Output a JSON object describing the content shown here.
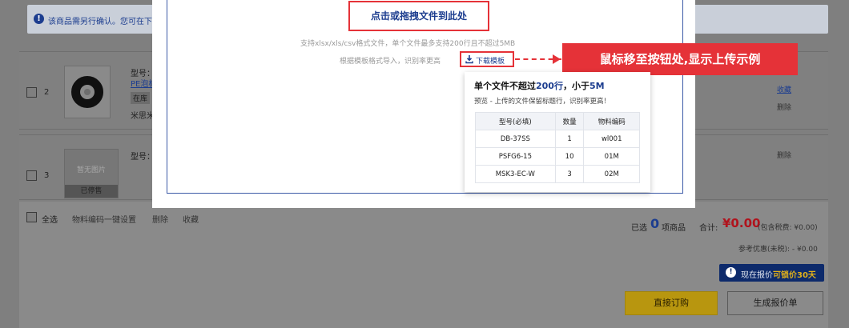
{
  "notice": {
    "icon": "info-icon",
    "text": "该商品需另行确认。您可在下"
  },
  "cart_rows": [
    {
      "index": "2",
      "model_label": "型号：",
      "link": "PE泡棉",
      "tag": "在库",
      "brand": "米思米",
      "actions": [
        "收藏",
        "删除"
      ]
    },
    {
      "index": "3",
      "model_label": "型号：",
      "placeholder_text": "暂无图片",
      "status": "已停售",
      "actions": [
        "删除"
      ]
    }
  ],
  "footer": {
    "select_all": "全选",
    "links": [
      "物料编码一键设置",
      "删除",
      "收藏"
    ],
    "selected_prefix": "已选",
    "selected_count": "0",
    "selected_suffix": "项商品",
    "total_label": "合计:",
    "total_value": "¥0.00",
    "tax_note": "(包含税费: ¥0.00)",
    "reference": "参考优惠(未税): - ¥0.00",
    "lock_prefix": "现在报价",
    "lock_highlight": "可锁价30天",
    "btn_order": "直接订购",
    "btn_quote": "生成报价单"
  },
  "modal": {
    "drop_label": "点击或拖拽文件到此处",
    "hint_formats": "支持xlsx/xls/csv格式文件，单个文件最多支持200行且不超过5MB",
    "hint_template": "根据模板格式导入，识别率更高",
    "download_label": "下载模板",
    "callout": "鼠标移至按钮处,显示上传示例",
    "tooltip": {
      "title_prefix": "单个文件不超过",
      "title_rows": "200行",
      "title_mid": "，小于",
      "title_size": "5M",
      "subtitle": "预览 - 上传的文件保留标题行，识别率更高！",
      "headers": [
        "型号(必填)",
        "数量",
        "物料编码"
      ],
      "rows": [
        [
          "DB-37SS",
          "1",
          "wl001"
        ],
        [
          "PSFG6-15",
          "10",
          "01M"
        ],
        [
          "MSK3-EC-W",
          "3",
          "02M"
        ]
      ]
    }
  },
  "colors": {
    "accent": "#1c3d8f",
    "highlight": "#e53238",
    "price": "#b0131d",
    "order_button": "#b8960f"
  }
}
